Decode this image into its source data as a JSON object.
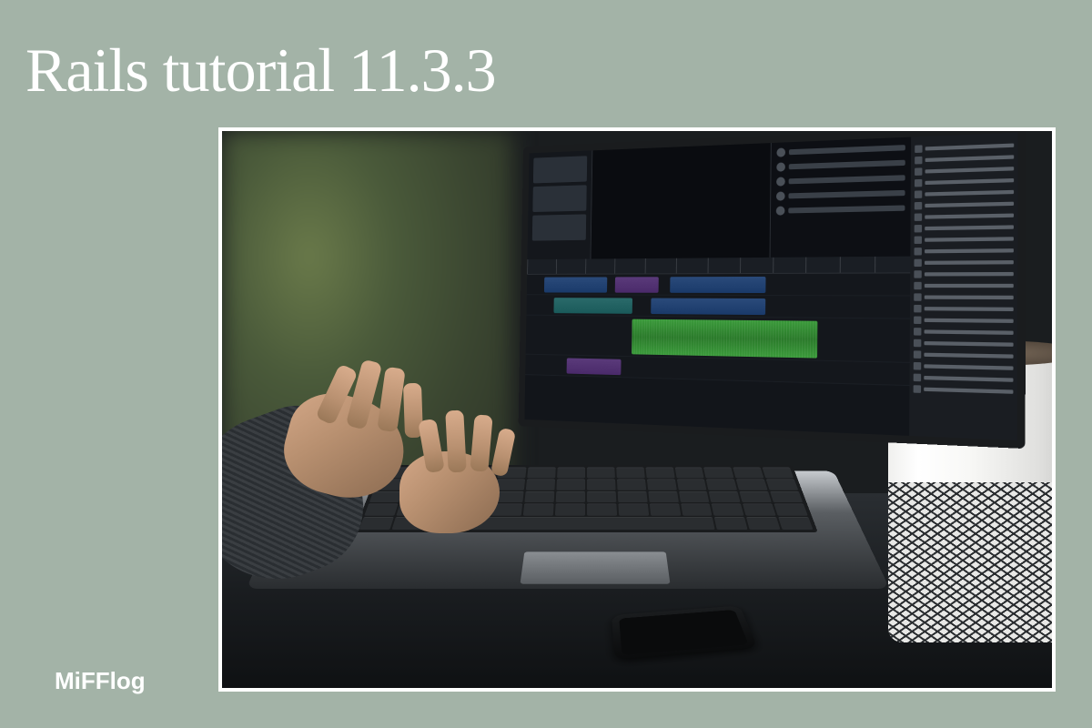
{
  "title": "Rails tutorial 11.3.3",
  "brand": "MiFFlog",
  "colors": {
    "background": "#a3b3a7",
    "title_text": "#ffffff",
    "brand_text": "#ffffff",
    "frame_border": "#ffffff"
  }
}
